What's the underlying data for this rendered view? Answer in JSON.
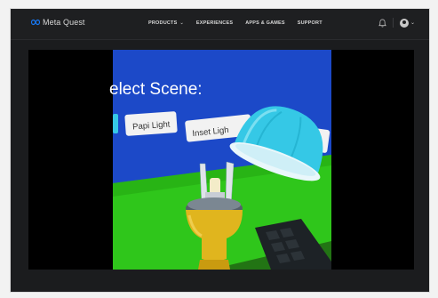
{
  "header": {
    "brand": "Meta Quest",
    "nav": [
      {
        "label": "PRODUCTS",
        "has_dropdown": true
      },
      {
        "label": "EXPERIENCES",
        "has_dropdown": false
      },
      {
        "label": "APPS & GAMES",
        "has_dropdown": false
      },
      {
        "label": "SUPPORT",
        "has_dropdown": false
      }
    ],
    "icons": [
      "notification-bell-icon",
      "avatar-icon"
    ]
  },
  "video": {
    "scene_title": "elect Scene:",
    "buttons": [
      "Papi Light",
      "Inset Ligh",
      "ach"
    ],
    "colors": {
      "sky": "#1c49c8",
      "ground": "#2fc61b",
      "light_dome": "#35c8e6",
      "post": "#e0b51e"
    }
  }
}
